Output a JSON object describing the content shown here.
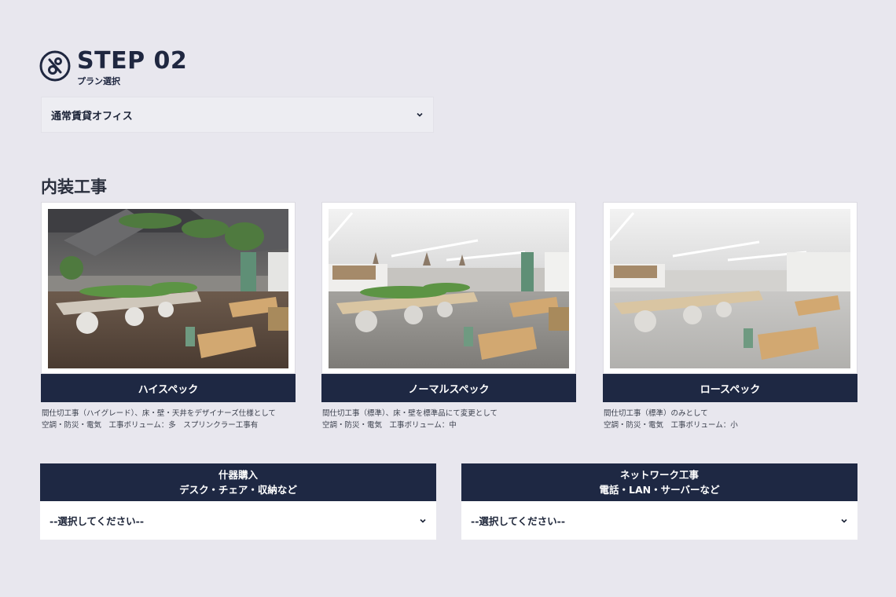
{
  "step": {
    "title": "STEP 02",
    "subtitle": "プラン選択",
    "logo_icon": "step-logo-icon"
  },
  "plan": {
    "selected": "通常賃貸オフィス",
    "icon": "chevron-down-icon"
  },
  "section": {
    "title": "内装工事"
  },
  "cards": [
    {
      "label": "ハイスペック",
      "desc1": "間仕切工事（ハイグレード）、床・壁・天井をデザイナーズ仕様として",
      "desc2": "空調・防災・電気　工事ボリューム：多　スプリンクラー工事有"
    },
    {
      "label": "ノーマルスペック",
      "desc1": "間仕切工事（標準）、床・壁を標準品にて変更として",
      "desc2": "空調・防災・電気　工事ボリューム：中"
    },
    {
      "label": "ロースペック",
      "desc1": "間仕切工事（標準）のみとして",
      "desc2": "空調・防災・電気　工事ボリューム：小"
    }
  ],
  "addons": [
    {
      "line1": "什器購入",
      "line2": "デスク・チェア・収納など",
      "selected": "--選択してください--"
    },
    {
      "line1": "ネットワーク工事",
      "line2": "電話・LAN・サーバーなど",
      "selected": "--選択してください--"
    }
  ],
  "colors": {
    "navy": "#1e2843",
    "background": "#e8e7ee",
    "accent_green": "#5f8f76"
  }
}
